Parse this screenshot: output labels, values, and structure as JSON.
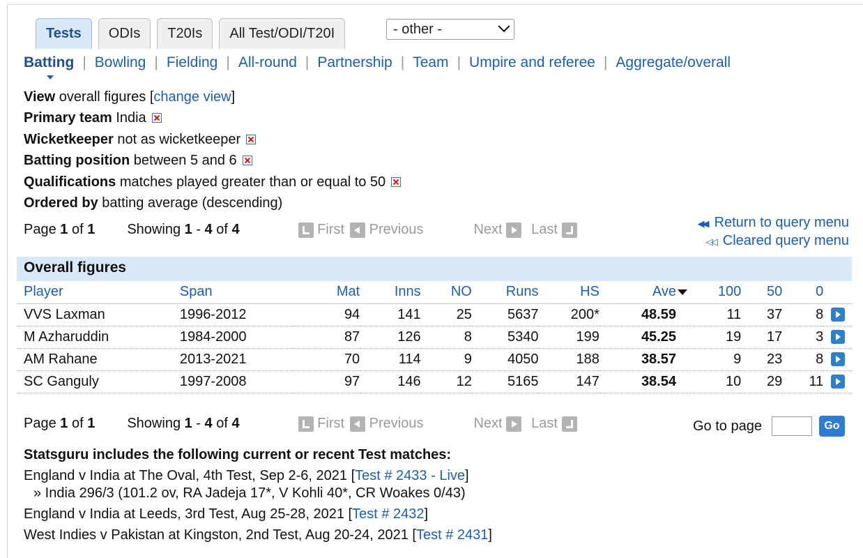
{
  "tabs": [
    {
      "label": "Tests",
      "active": true
    },
    {
      "label": "ODIs",
      "active": false
    },
    {
      "label": "T20Is",
      "active": false
    },
    {
      "label": "All Test/ODI/T20I",
      "active": false
    }
  ],
  "other_select": {
    "value": "- other -"
  },
  "subnav": [
    "Batting",
    "Bowling",
    "Fielding",
    "All-round",
    "Partnership",
    "Team",
    "Umpire and referee",
    "Aggregate/overall"
  ],
  "filters": {
    "view_label": "View",
    "view_value": "overall figures [",
    "change_view": "change view",
    "view_close": "]",
    "primary_label": "Primary team",
    "primary_value": "India",
    "wk_label": "Wicketkeeper",
    "wk_value": "not as wicketkeeper",
    "bp_label": "Batting position",
    "bp_value": "between 5 and 6",
    "qual_label": "Qualifications",
    "qual_value": "matches played greater than or equal to 50",
    "order_label": "Ordered by",
    "order_value": "batting average (descending)"
  },
  "pager": {
    "page_word": "Page",
    "page": "1",
    "of_word": "of",
    "pages": "1",
    "showing_word": "Showing",
    "from": "1",
    "dash": "-",
    "to": "4",
    "of2": "of",
    "total": "4",
    "first": "First",
    "previous": "Previous",
    "next": "Next",
    "last": "Last"
  },
  "query_links": {
    "return": "Return to query menu",
    "cleared": "Cleared query menu"
  },
  "panel_title": "Overall figures",
  "table": {
    "headers": [
      "Player",
      "Span",
      "Mat",
      "Inns",
      "NO",
      "Runs",
      "HS",
      "Ave",
      "100",
      "50",
      "0"
    ],
    "rows": [
      [
        "VVS Laxman",
        "1996-2012",
        "94",
        "141",
        "25",
        "5637",
        "200*",
        "48.59",
        "11",
        "37",
        "8"
      ],
      [
        "M Azharuddin",
        "1984-2000",
        "87",
        "126",
        "8",
        "5340",
        "199",
        "45.25",
        "19",
        "17",
        "3"
      ],
      [
        "AM Rahane",
        "2013-2021",
        "70",
        "114",
        "9",
        "4050",
        "188",
        "38.57",
        "9",
        "23",
        "8"
      ],
      [
        "SC Ganguly",
        "1997-2008",
        "97",
        "146",
        "12",
        "5165",
        "147",
        "38.54",
        "10",
        "29",
        "11"
      ]
    ]
  },
  "goto": {
    "label": "Go to page",
    "button": "Go"
  },
  "recent": {
    "title": "Statsguru includes the following current or recent Test matches:",
    "m1_text": "England v India at The Oval, 4th Test, Sep 2-6, 2021 [",
    "m1_link": "Test # 2433 - Live",
    "m1_close": "]",
    "m1_score": "» India 296/3 (101.2 ov, RA Jadeja 17*, V Kohli 40*, CR Woakes 0/43)",
    "m2_text": "England v India at Leeds, 3rd Test, Aug 25-28, 2021 [",
    "m2_link": "Test # 2432",
    "m2_close": "]",
    "m3_text": "West Indies v Pakistan at Kingston, 2nd Test, Aug 20-24, 2021 [",
    "m3_link": "Test # 2431",
    "m3_close": "]"
  }
}
